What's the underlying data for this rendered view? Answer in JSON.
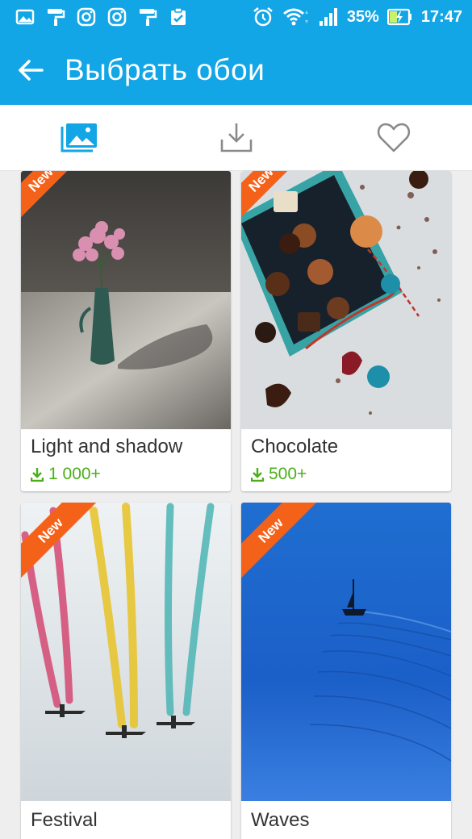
{
  "status_bar": {
    "battery": "35%",
    "time": "17:47"
  },
  "app_bar": {
    "title": "Выбрать обои",
    "back_icon": "arrow-left-icon"
  },
  "tabs": [
    {
      "name": "gallery",
      "icon": "image-gallery-icon",
      "selected": true
    },
    {
      "name": "downloads",
      "icon": "download-icon",
      "selected": false
    },
    {
      "name": "favorites",
      "icon": "heart-icon",
      "selected": false
    }
  ],
  "wallpapers": [
    {
      "title": "Light and shadow",
      "downloads": "1 000+",
      "badge": "New"
    },
    {
      "title": "Chocolate",
      "downloads": "500+",
      "badge": "New"
    },
    {
      "title": "Festival",
      "badge": "New"
    },
    {
      "title": "Waves",
      "badge": "New"
    }
  ],
  "colors": {
    "primary": "#13a6e6",
    "badge": "#f4621a",
    "download_count": "#4caf1a"
  }
}
